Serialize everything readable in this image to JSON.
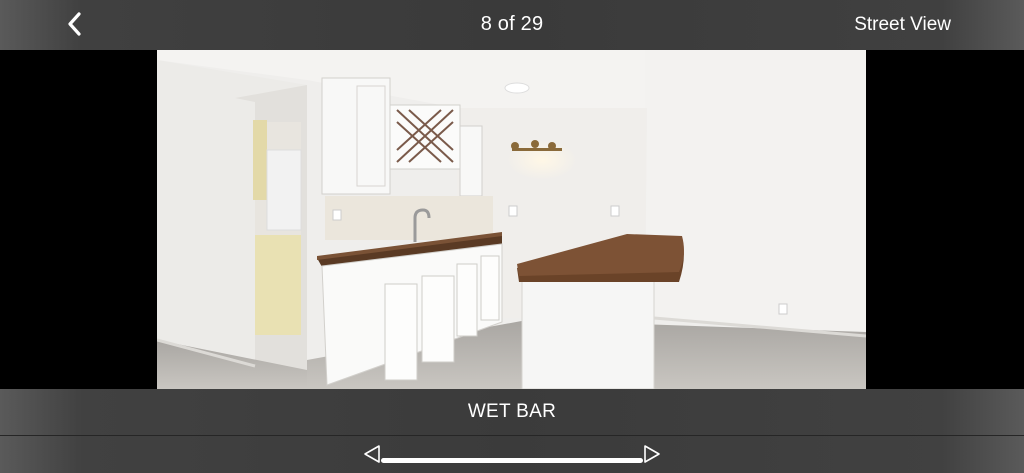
{
  "header": {
    "counter_text": "8 of 29",
    "street_view_label": "Street View"
  },
  "photo": {
    "caption": "WET BAR"
  },
  "gallery": {
    "current_index": 8,
    "total": 29
  },
  "icons": {
    "back": "chevron-left-icon",
    "prev": "triangle-left-icon",
    "next": "triangle-right-icon"
  },
  "colors": {
    "bar_background": "#3b3b3b",
    "text": "#ffffff",
    "photo_letterbox": "#000000"
  }
}
